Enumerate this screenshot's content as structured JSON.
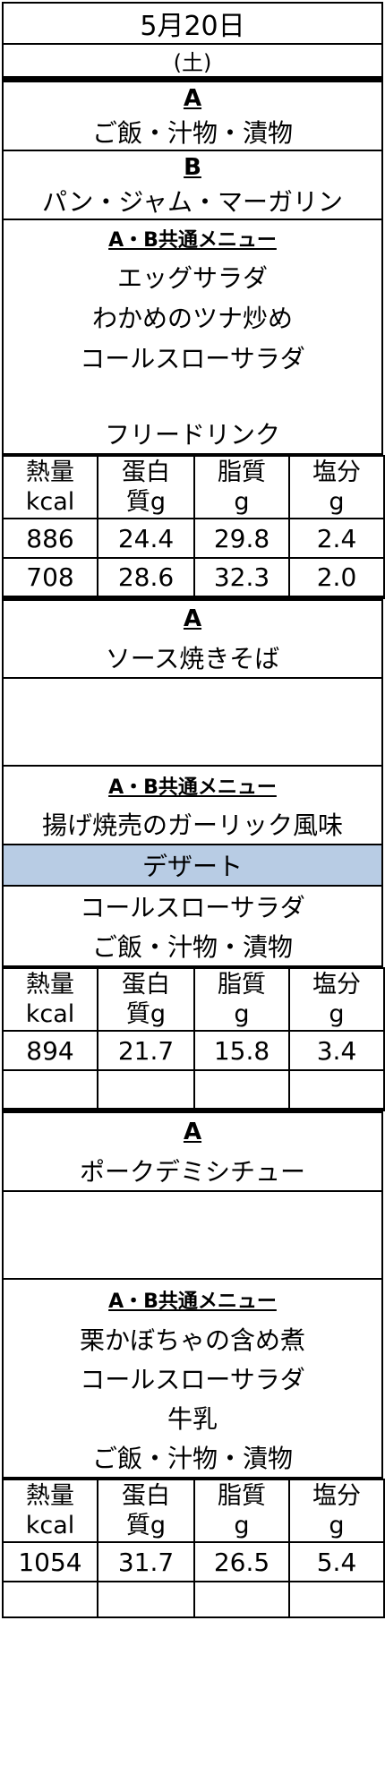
{
  "date": "5月20日",
  "weekday": "(土)",
  "breakfast": {
    "a_label": "A",
    "a_menu": "ご飯・汁物・漬物",
    "b_label": "B",
    "b_menu": "パン・ジャム・マーガリン",
    "common_label": "A・B共通メニュー",
    "items": [
      "エッグサラダ",
      "わかめのツナ炒め",
      "コールスローサラダ",
      "フリードリンク"
    ],
    "nutrition_headers": [
      "熱量\nkcal",
      "蛋白\n質g",
      "脂質\ng",
      "塩分\ng"
    ],
    "rows": [
      [
        "886",
        "24.4",
        "29.8",
        "2.4"
      ],
      [
        "708",
        "28.6",
        "32.3",
        "2.0"
      ]
    ]
  },
  "lunch": {
    "a_label": "A",
    "a_menu": "ソース焼きそば",
    "common_label": "A・B共通メニュー",
    "items": [
      "揚げ焼売のガーリック風味",
      "デザート",
      "コールスローサラダ",
      "ご飯・汁物・漬物"
    ],
    "nutrition_headers": [
      "熱量\nkcal",
      "蛋白\n質g",
      "脂質\ng",
      "塩分\ng"
    ],
    "rows": [
      [
        "894",
        "21.7",
        "15.8",
        "3.4"
      ]
    ]
  },
  "dinner": {
    "a_label": "A",
    "a_menu": "ポークデミシチュー",
    "common_label": "A・B共通メニュー",
    "items": [
      "栗かぼちゃの含め煮",
      "コールスローサラダ",
      "牛乳",
      "ご飯・汁物・漬物"
    ],
    "nutrition_headers": [
      "熱量\nkcal",
      "蛋白\n質g",
      "脂質\ng",
      "塩分\ng"
    ],
    "rows": [
      [
        "1054",
        "31.7",
        "26.5",
        "5.4"
      ]
    ]
  },
  "colors": {
    "dessert_highlight": "#b8cce4"
  }
}
